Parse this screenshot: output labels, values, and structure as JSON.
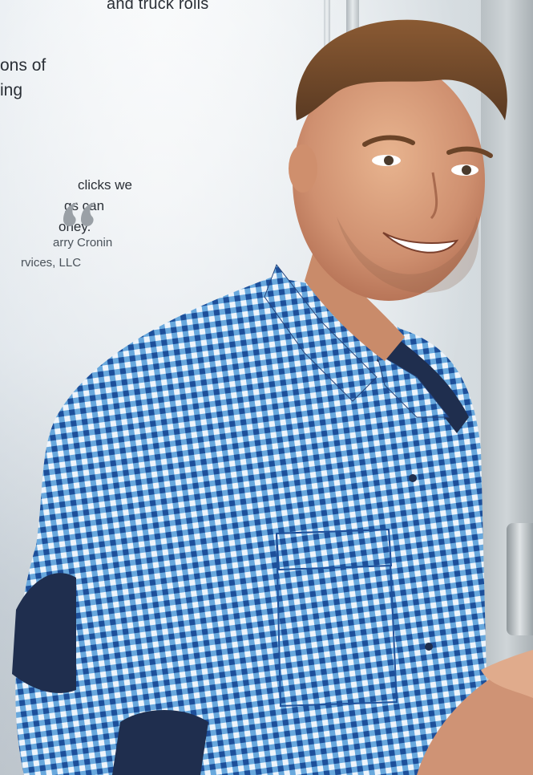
{
  "text_overlay": {
    "top_line": "and truck rolls",
    "body_lines": [
      "ons of",
      "ing"
    ],
    "quote_lines": [
      "clicks we",
      "gs can",
      "oney."
    ],
    "attribution_lines": [
      "arry Cronin",
      "rvices, LLC"
    ]
  },
  "icons": {
    "quote": "closing-quote-icon"
  },
  "colors": {
    "text": "#2a2f36",
    "quote_mark": "#9aa0a6",
    "shirt_blue": "#2f7fc4",
    "collar_navy": "#1f2e4e"
  }
}
